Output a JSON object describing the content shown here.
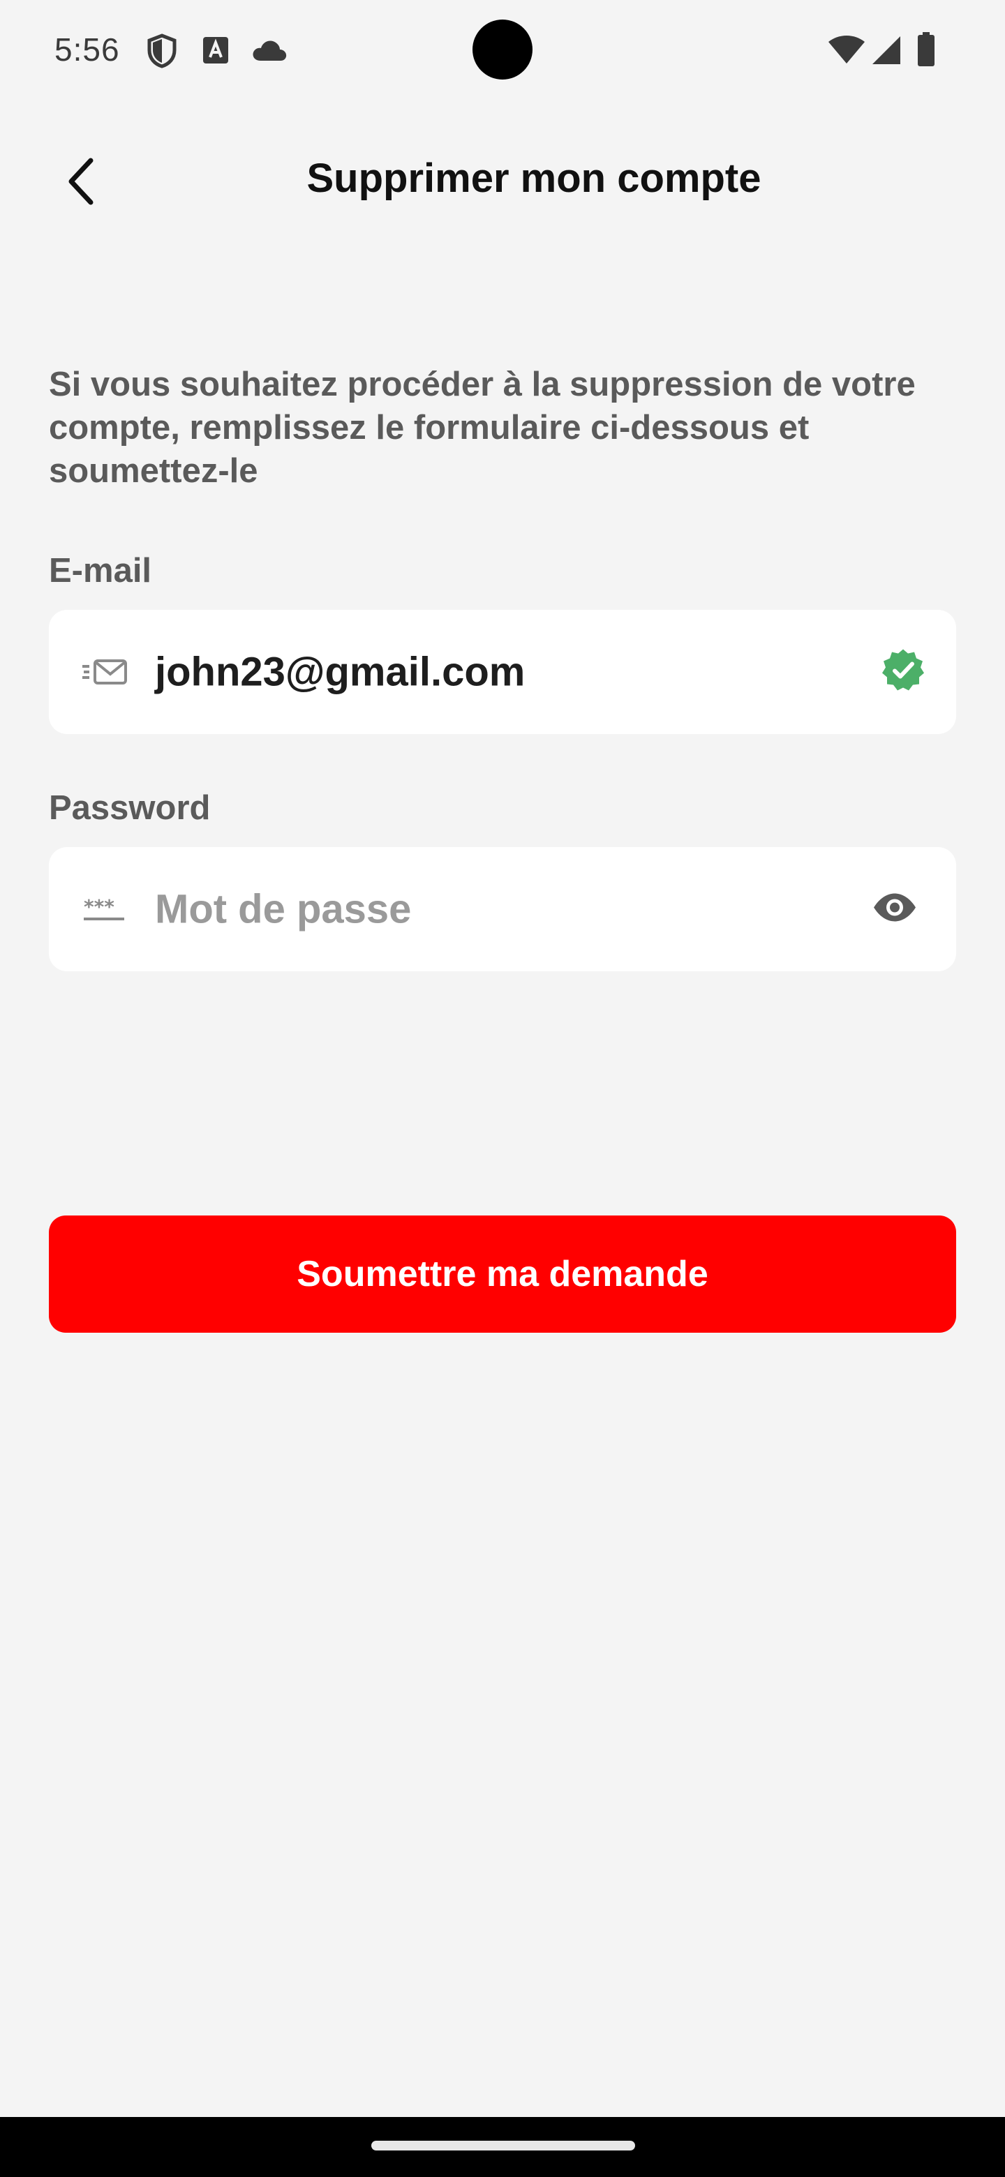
{
  "status_bar": {
    "time": "5:56",
    "left_icons": [
      "shield-icon",
      "font-a-icon",
      "cloud-icon"
    ],
    "right_icons": [
      "wifi-icon",
      "cell-signal-icon",
      "battery-icon"
    ]
  },
  "header": {
    "back_icon": "chevron-left-icon",
    "title": "Supprimer mon compte"
  },
  "description": "Si vous souhaitez procéder à la suppression de votre compte, remplissez le formulaire ci-dessous et soumettez-le",
  "form": {
    "email": {
      "label": "E-mail",
      "value": "john23@gmail.com",
      "leading_icon": "envelope-icon",
      "trailing_icon": "verified-check-icon",
      "verified_color": "#4caf68"
    },
    "password": {
      "label": "Password",
      "value": "",
      "placeholder": "Mot de passe",
      "leading_icon": "password-dots-icon",
      "trailing_icon": "eye-icon"
    }
  },
  "submit_button": {
    "label": "Soumettre ma demande",
    "color": "#ff0000"
  }
}
